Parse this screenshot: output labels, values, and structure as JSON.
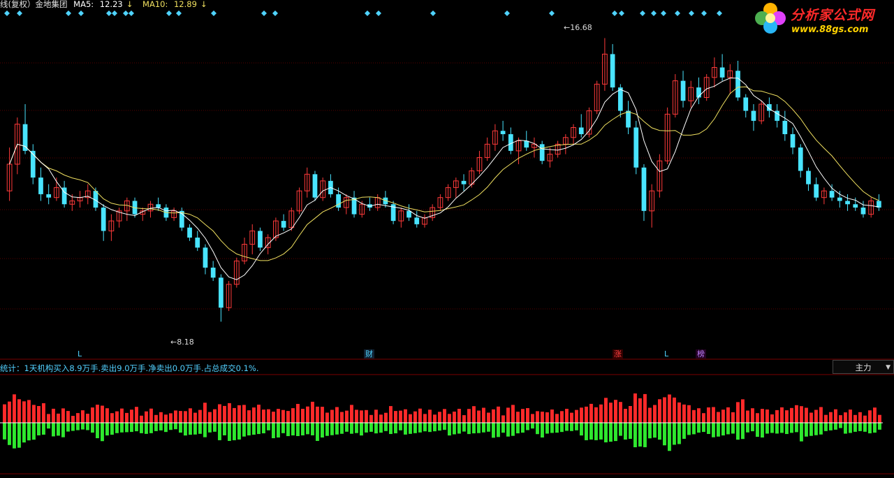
{
  "header": {
    "title": "线(复权）金地集团",
    "ma5_label": "MA5:",
    "ma5_value": "12.23",
    "ma10_label": "MA10:",
    "ma10_value": "12.89",
    "arrow": "↓"
  },
  "logo": {
    "name": "分析家公式网",
    "url": "www.88gs.com"
  },
  "info_line": "统计：1天机构买入8.9万手.卖出9.0万手.净卖出0.0万手.占总成交0.1%.",
  "indicator_select": {
    "value": "主力"
  },
  "markers": [
    {
      "text": "L",
      "kind": "L"
    },
    {
      "text": "财",
      "kind": "cai"
    },
    {
      "text": "涨",
      "kind": "zhang"
    },
    {
      "text": "L",
      "kind": "L"
    },
    {
      "text": "榜",
      "kind": "bang"
    }
  ],
  "annotations": {
    "high": "16.68",
    "low": "8.18"
  },
  "colors": {
    "up": "#ff3a3a",
    "down": "#49e4ff",
    "ma5": "#ffffff",
    "ma10": "#f0e060",
    "grid": "#5a0000",
    "flow_up": "#ff2a2a",
    "flow_down": "#2ee82e",
    "diamond": "#4fd3ff"
  },
  "chart_data": {
    "type": "candlestick",
    "title": "金地集团",
    "y_range": [
      8.18,
      16.68
    ],
    "high": 16.68,
    "low": 8.18,
    "series": [
      {
        "name": "MA5",
        "last": 12.23
      },
      {
        "name": "MA10",
        "last": 12.89
      }
    ],
    "ohlc": [
      [
        12.1,
        13.4,
        11.8,
        12.9
      ],
      [
        12.9,
        14.3,
        12.6,
        14.1
      ],
      [
        14.1,
        14.7,
        13.2,
        13.3
      ],
      [
        13.3,
        13.5,
        12.3,
        12.5
      ],
      [
        12.5,
        12.8,
        11.8,
        12.0
      ],
      [
        12.0,
        12.3,
        11.7,
        11.9
      ],
      [
        11.9,
        12.5,
        11.8,
        12.2
      ],
      [
        12.2,
        12.4,
        11.6,
        11.7
      ],
      [
        11.7,
        12.0,
        11.5,
        11.8
      ],
      [
        11.8,
        12.1,
        11.6,
        11.9
      ],
      [
        11.9,
        12.3,
        11.7,
        12.1
      ],
      [
        12.1,
        12.2,
        11.5,
        11.6
      ],
      [
        11.6,
        11.7,
        10.6,
        10.9
      ],
      [
        10.9,
        11.4,
        10.6,
        11.2
      ],
      [
        11.2,
        11.6,
        11.0,
        11.5
      ],
      [
        11.5,
        11.9,
        11.2,
        11.8
      ],
      [
        11.8,
        11.9,
        11.3,
        11.4
      ],
      [
        11.4,
        11.6,
        11.2,
        11.5
      ],
      [
        11.5,
        11.8,
        11.3,
        11.7
      ],
      [
        11.7,
        11.9,
        11.5,
        11.6
      ],
      [
        11.6,
        11.7,
        11.2,
        11.3
      ],
      [
        11.3,
        11.6,
        11.2,
        11.5
      ],
      [
        11.5,
        11.6,
        10.9,
        11.0
      ],
      [
        11.0,
        11.1,
        10.6,
        10.7
      ],
      [
        10.7,
        10.9,
        10.3,
        10.4
      ],
      [
        10.4,
        10.5,
        9.6,
        9.8
      ],
      [
        9.8,
        10.0,
        9.4,
        9.5
      ],
      [
        9.5,
        9.6,
        8.18,
        8.6
      ],
      [
        8.6,
        9.4,
        8.5,
        9.3
      ],
      [
        9.3,
        10.1,
        9.2,
        10.0
      ],
      [
        10.0,
        10.7,
        9.9,
        10.5
      ],
      [
        10.5,
        11.1,
        10.2,
        10.9
      ],
      [
        10.9,
        11.0,
        10.3,
        10.4
      ],
      [
        10.4,
        10.8,
        10.2,
        10.7
      ],
      [
        10.7,
        11.3,
        10.6,
        11.2
      ],
      [
        11.2,
        11.4,
        10.9,
        11.0
      ],
      [
        11.0,
        11.6,
        10.9,
        11.5
      ],
      [
        11.5,
        12.2,
        11.4,
        12.1
      ],
      [
        12.1,
        12.8,
        11.9,
        12.6
      ],
      [
        12.6,
        12.7,
        11.8,
        11.9
      ],
      [
        11.9,
        12.5,
        11.8,
        12.4
      ],
      [
        12.4,
        12.6,
        11.9,
        12.0
      ],
      [
        12.0,
        12.2,
        11.5,
        11.6
      ],
      [
        11.6,
        12.0,
        11.4,
        11.9
      ],
      [
        11.9,
        12.1,
        11.3,
        11.4
      ],
      [
        11.4,
        11.8,
        11.3,
        11.7
      ],
      [
        11.7,
        11.9,
        11.5,
        11.6
      ],
      [
        11.6,
        12.0,
        11.5,
        11.9
      ],
      [
        11.9,
        12.1,
        11.6,
        11.7
      ],
      [
        11.7,
        11.8,
        11.1,
        11.2
      ],
      [
        11.2,
        11.6,
        11.0,
        11.5
      ],
      [
        11.5,
        11.7,
        11.2,
        11.3
      ],
      [
        11.3,
        11.5,
        11.0,
        11.1
      ],
      [
        11.1,
        11.4,
        11.0,
        11.3
      ],
      [
        11.3,
        11.7,
        11.2,
        11.6
      ],
      [
        11.6,
        12.0,
        11.5,
        11.9
      ],
      [
        11.9,
        12.3,
        11.8,
        12.2
      ],
      [
        12.2,
        12.5,
        11.9,
        12.4
      ],
      [
        12.4,
        12.6,
        12.1,
        12.3
      ],
      [
        12.3,
        12.8,
        12.2,
        12.7
      ],
      [
        12.7,
        13.3,
        12.6,
        13.1
      ],
      [
        13.1,
        13.7,
        13.0,
        13.5
      ],
      [
        13.5,
        14.1,
        13.3,
        13.9
      ],
      [
        13.9,
        14.2,
        13.6,
        13.8
      ],
      [
        13.8,
        14.0,
        13.2,
        13.3
      ],
      [
        13.3,
        13.7,
        12.9,
        13.6
      ],
      [
        13.6,
        13.9,
        13.3,
        13.4
      ],
      [
        13.4,
        13.7,
        13.1,
        13.5
      ],
      [
        13.5,
        13.6,
        12.9,
        13.0
      ],
      [
        13.0,
        13.4,
        12.8,
        13.2
      ],
      [
        13.2,
        13.6,
        13.1,
        13.5
      ],
      [
        13.5,
        13.8,
        13.2,
        13.7
      ],
      [
        13.7,
        14.1,
        13.5,
        14.0
      ],
      [
        14.0,
        14.4,
        13.7,
        13.8
      ],
      [
        13.8,
        14.6,
        13.7,
        14.5
      ],
      [
        14.5,
        15.4,
        14.4,
        15.3
      ],
      [
        15.3,
        16.68,
        15.1,
        16.2
      ],
      [
        16.2,
        16.5,
        15.1,
        15.2
      ],
      [
        15.2,
        15.3,
        14.3,
        14.5
      ],
      [
        14.5,
        14.8,
        13.8,
        14.0
      ],
      [
        14.0,
        14.2,
        12.6,
        12.8
      ],
      [
        12.8,
        12.9,
        11.2,
        11.5
      ],
      [
        11.5,
        12.3,
        11.0,
        12.1
      ],
      [
        12.1,
        13.2,
        11.9,
        13.0
      ],
      [
        13.0,
        14.6,
        12.9,
        14.4
      ],
      [
        14.4,
        15.6,
        14.3,
        15.4
      ],
      [
        15.4,
        15.7,
        14.6,
        14.8
      ],
      [
        14.8,
        15.4,
        14.6,
        15.2
      ],
      [
        15.2,
        15.5,
        14.7,
        14.9
      ],
      [
        14.9,
        15.6,
        14.8,
        15.5
      ],
      [
        15.5,
        16.1,
        15.2,
        15.8
      ],
      [
        15.8,
        16.2,
        15.4,
        15.5
      ],
      [
        15.5,
        15.9,
        15.0,
        15.7
      ],
      [
        15.7,
        16.0,
        14.8,
        14.9
      ],
      [
        14.9,
        15.0,
        14.3,
        14.5
      ],
      [
        14.5,
        14.7,
        13.9,
        14.2
      ],
      [
        14.2,
        14.8,
        14.1,
        14.7
      ],
      [
        14.7,
        14.9,
        14.3,
        14.5
      ],
      [
        14.5,
        14.7,
        14.0,
        14.2
      ],
      [
        14.2,
        14.5,
        13.6,
        13.8
      ],
      [
        13.8,
        14.0,
        13.2,
        13.4
      ],
      [
        13.4,
        13.5,
        12.5,
        12.7
      ],
      [
        12.7,
        12.8,
        12.1,
        12.3
      ],
      [
        12.3,
        12.5,
        11.8,
        11.9
      ],
      [
        11.9,
        12.2,
        11.7,
        12.1
      ],
      [
        12.1,
        12.3,
        11.8,
        11.9
      ],
      [
        11.9,
        12.1,
        11.6,
        11.8
      ],
      [
        11.8,
        12.0,
        11.5,
        11.7
      ],
      [
        11.7,
        11.9,
        11.5,
        11.6
      ],
      [
        11.6,
        11.8,
        11.3,
        11.4
      ],
      [
        11.4,
        11.9,
        11.3,
        11.8
      ],
      [
        11.8,
        12.0,
        11.5,
        11.6
      ]
    ]
  }
}
